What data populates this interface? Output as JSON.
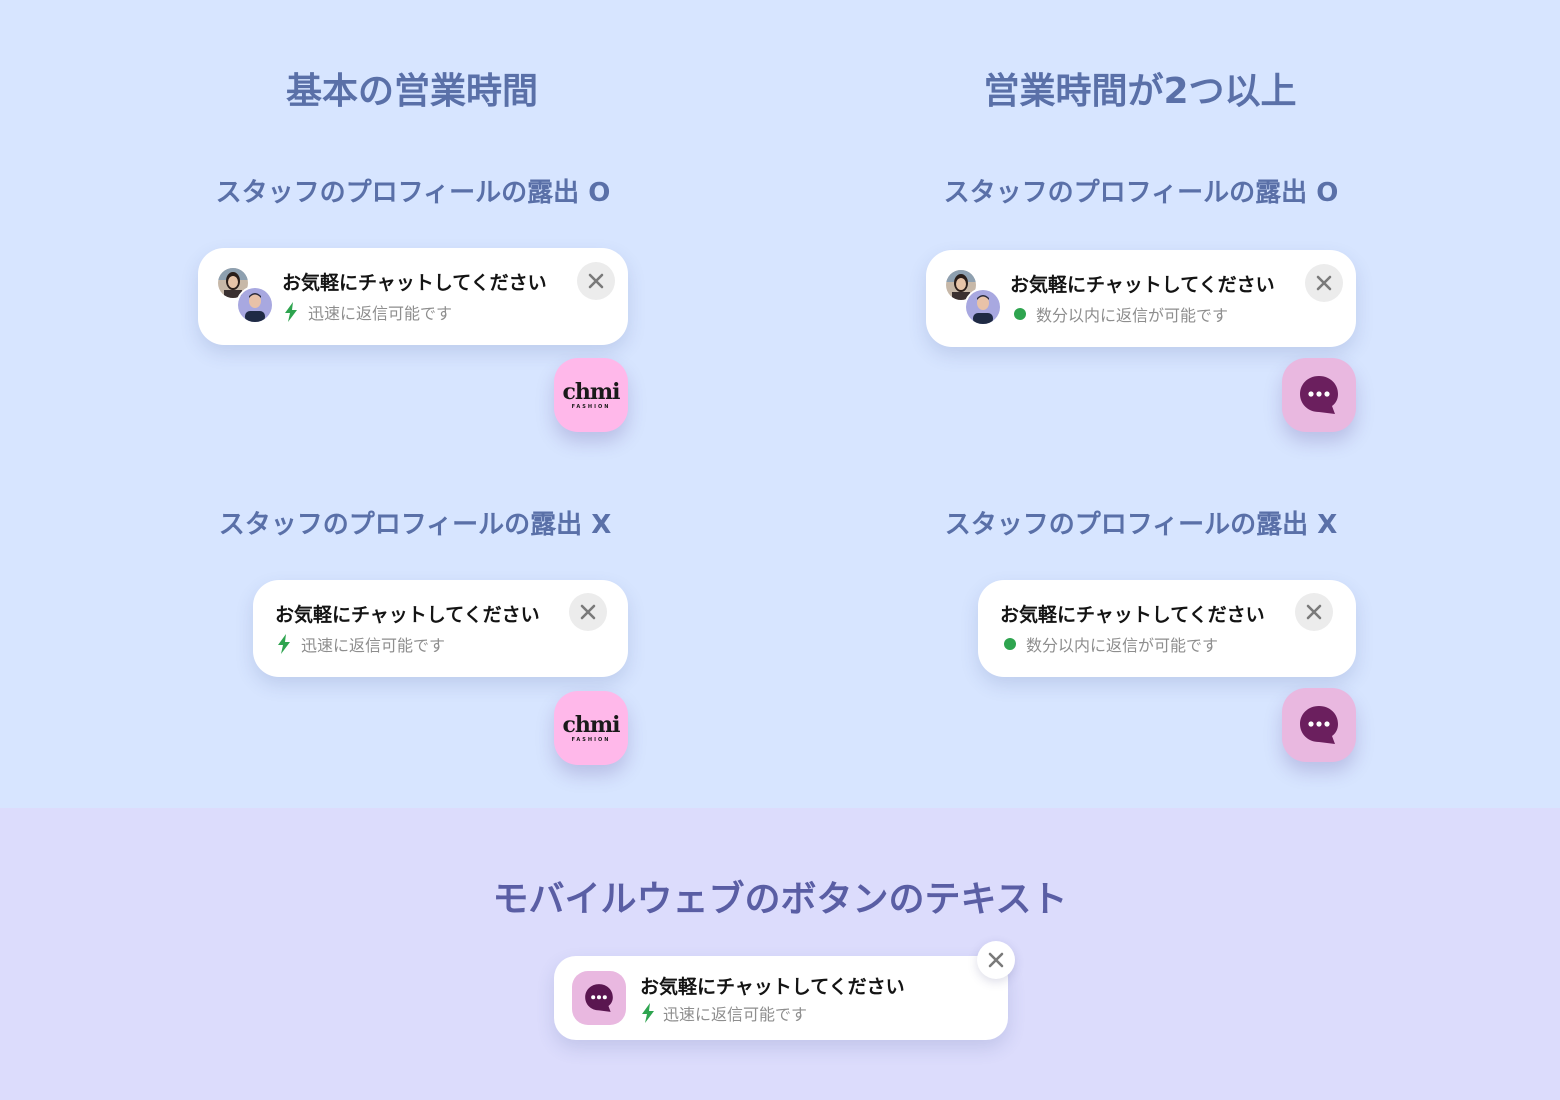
{
  "headings": {
    "left": "基本の営業時間",
    "right": "営業時間が2つ以上",
    "bottom": "モバイルウェブのボタンのテキスト"
  },
  "subheadings": {
    "profile_on": "スタッフのプロフィールの露出 O",
    "profile_off": "スタッフのプロフィールの露出 X"
  },
  "card": {
    "title": "お気軽にチャットしてください",
    "status_fast": "迅速に返信可能です",
    "status_minutes": "数分以内に返信が可能です",
    "status_fast_icon": "lightning-icon",
    "status_minutes_icon": "green-dot-icon"
  },
  "brand": {
    "logo": "chmi",
    "sub": "FASHION"
  },
  "icons": {
    "close": "close-icon",
    "chat": "chat-bubble-icon"
  },
  "colors": {
    "top_background": "#d7e5ff",
    "bottom_background": "#dcdcfc",
    "heading": "#5a70a8",
    "brand_fab": "#ffb8ea",
    "chat_fab": "#e9b8e0",
    "chat_icon": "#6b1f5e",
    "status_green": "#2ea44f"
  }
}
